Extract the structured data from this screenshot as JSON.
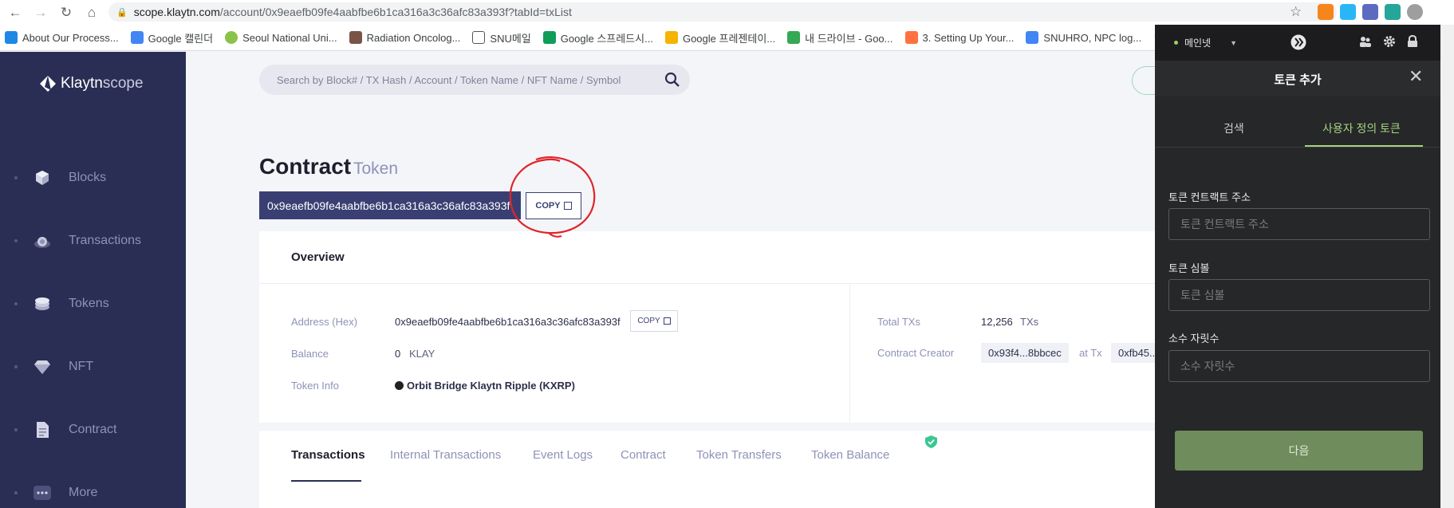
{
  "browser": {
    "url_host": "scope.klaytn.com",
    "url_path": "/account/0x9eaefb09fe4aabfbe6b1ca316a3c36afc83a393f?tabId=txList",
    "bookmarks": [
      {
        "label": "About Our Process...",
        "color": "#1e88e5"
      },
      {
        "label": "Google 캘린더",
        "color": "#4285f4"
      },
      {
        "label": "Seoul National Uni...",
        "color": "#8bc34a"
      },
      {
        "label": "Radiation Oncolog...",
        "color": "#795548"
      },
      {
        "label": "SNU메일",
        "color": "#555555"
      },
      {
        "label": "Google 스프레드시...",
        "color": "#0f9d58"
      },
      {
        "label": "Google 프레젠테이...",
        "color": "#f4b400"
      },
      {
        "label": "내 드라이브 - Goo...",
        "color": "#34a853"
      },
      {
        "label": "3. Setting Up Your...",
        "color": "#ff7043"
      },
      {
        "label": "SNUHRO, NPC log...",
        "color": "#4285f4"
      }
    ]
  },
  "sidebar": {
    "brand_main": "Klaytn",
    "brand_sub": "scope",
    "items": [
      {
        "label": "Blocks",
        "icon": "cube-icon"
      },
      {
        "label": "Transactions",
        "icon": "transaction-icon"
      },
      {
        "label": "Tokens",
        "icon": "coins-icon"
      },
      {
        "label": "NFT",
        "icon": "diamond-icon"
      },
      {
        "label": "Contract",
        "icon": "document-icon"
      },
      {
        "label": "More",
        "icon": "more-icon"
      }
    ]
  },
  "search": {
    "placeholder": "Search by Block# / TX Hash / Account / Token Name / NFT Name / Symbol"
  },
  "header": {
    "title": "Contract",
    "subtitle": "Token",
    "address": "0x9eaefb09fe4aabfbe6b1ca316a3c36afc83a393f",
    "copy_label": "COPY"
  },
  "overview": {
    "heading": "Overview",
    "address_label": "Address (Hex)",
    "address_value": "0x9eaefb09fe4aabfbe6b1ca316a3c36afc83a393f",
    "copy_label": "COPY",
    "balance_label": "Balance",
    "balance_value": "0",
    "balance_unit": "KLAY",
    "token_info_label": "Token Info",
    "token_info_value": "Orbit Bridge Klaytn Ripple (KXRP)",
    "total_txs_label": "Total TXs",
    "total_txs_value": "12,256",
    "total_txs_unit": "TXs",
    "creator_label": "Contract Creator",
    "creator_value": "0x93f4...8bbcec",
    "at_tx_label": "at Tx",
    "at_tx_value": "0xfb45..."
  },
  "tabs": [
    {
      "label": "Transactions",
      "active": true
    },
    {
      "label": "Internal Transactions",
      "active": false
    },
    {
      "label": "Event Logs",
      "active": false
    },
    {
      "label": "Contract",
      "active": false
    },
    {
      "label": "Token Transfers",
      "active": false
    },
    {
      "label": "Token Balance",
      "active": false
    }
  ],
  "wallet": {
    "network": "메인넷",
    "title": "토큰 추가",
    "tab_search": "검색",
    "tab_custom": "사용자 정의 토큰",
    "contract_label": "토큰 컨트랙트 주소",
    "contract_placeholder": "토큰 컨트랙트 주소",
    "symbol_label": "토큰 심볼",
    "symbol_placeholder": "토큰 심볼",
    "decimals_label": "소수 자릿수",
    "decimals_placeholder": "소수 자릿수",
    "next_label": "다음"
  },
  "colors": {
    "sidebar_bg": "#2a2e54",
    "accent_navy": "#3a3f73",
    "wallet_bg": "#262729",
    "wallet_accent": "#a4d47e",
    "next_button": "#6f8c5c",
    "annotation": "#e0242a"
  }
}
